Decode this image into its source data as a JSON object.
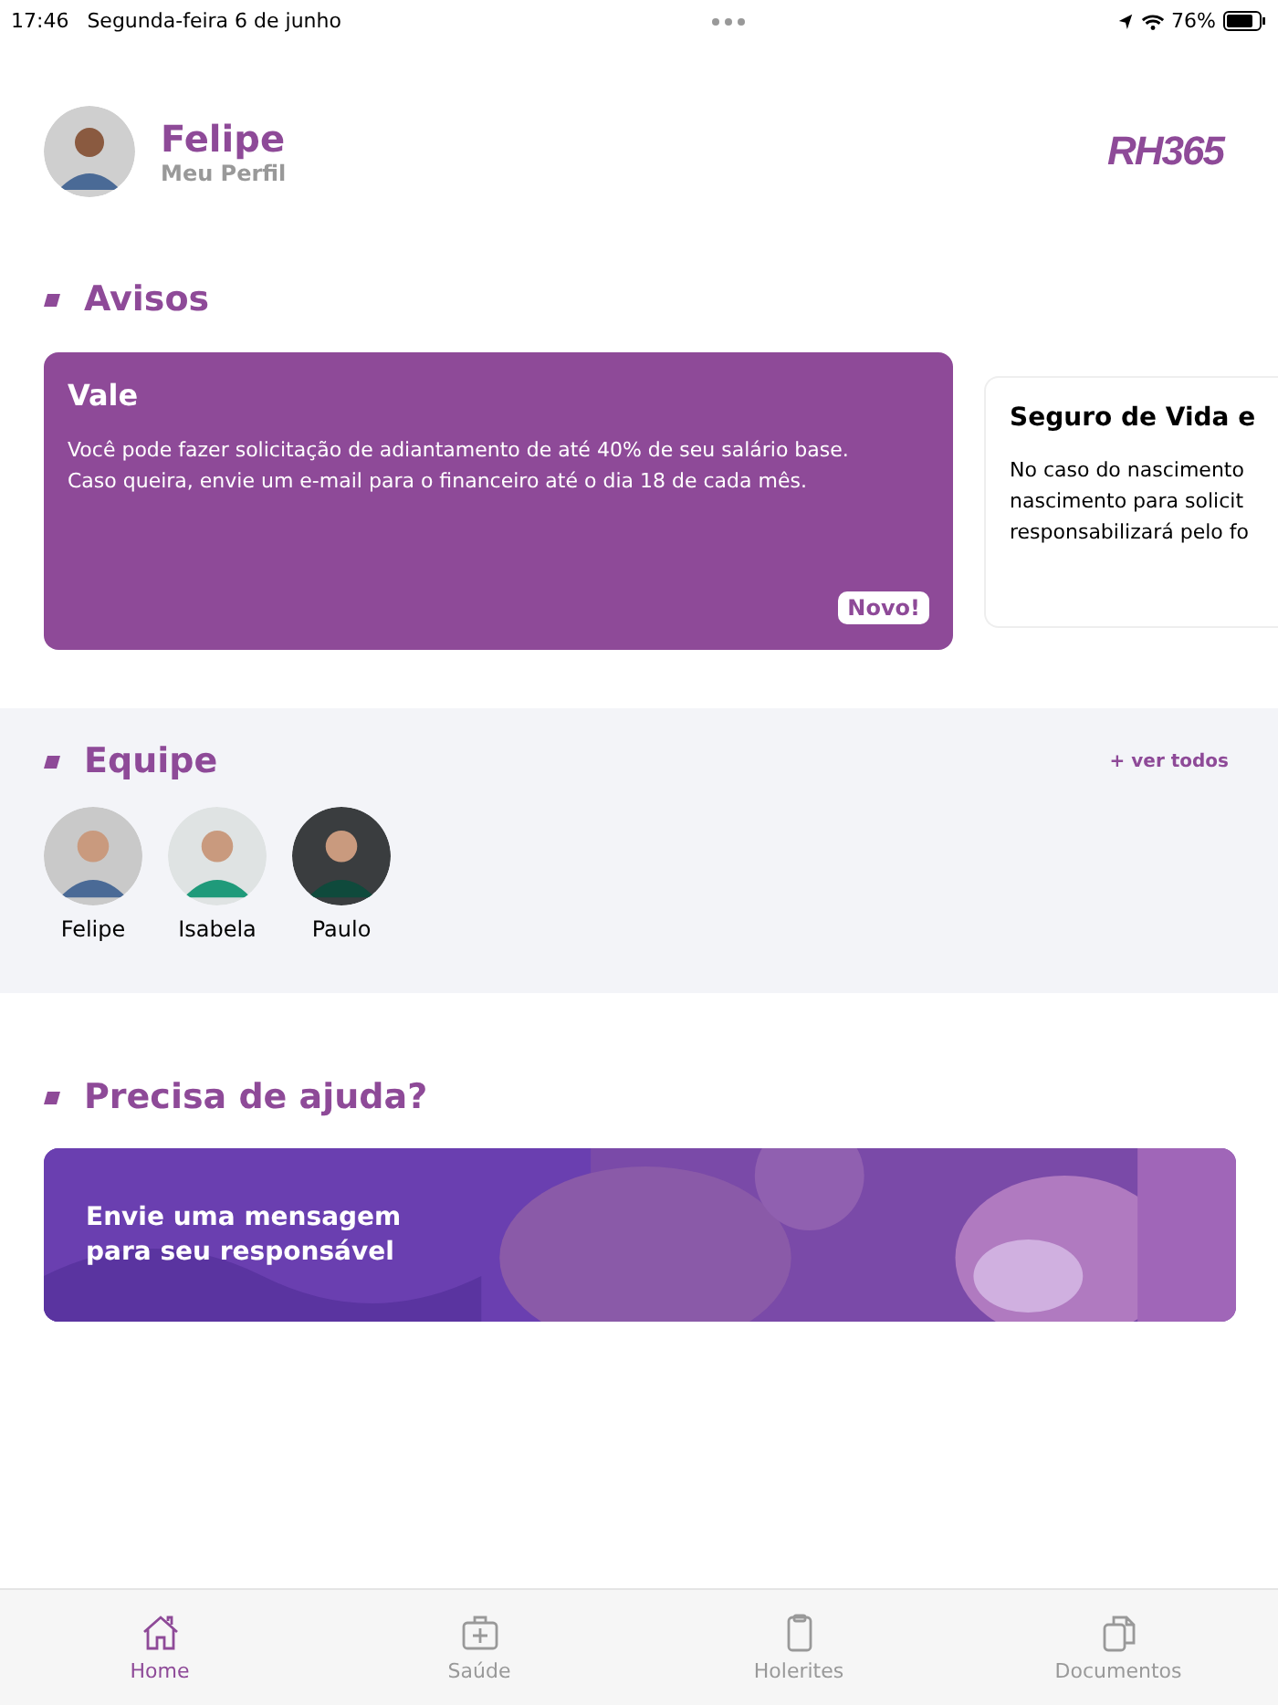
{
  "status_bar": {
    "time": "17:46",
    "date": "Segunda-feira 6 de junho",
    "battery": "76%"
  },
  "profile": {
    "name": "Felipe",
    "subtitle": "Meu Perfil",
    "logo": "RH365"
  },
  "notices": {
    "title": "Avisos",
    "cards": [
      {
        "kind": "highlight",
        "title": "Vale",
        "lines": [
          "Você pode fazer solicitação de adiantamento de até 40% de seu salário base. Caso queira, envie um e-mail para o financeiro até o dia 18 de cada mês."
        ],
        "badge": "Novo!"
      },
      {
        "kind": "plain",
        "title": "Seguro de Vida e",
        "lines": [
          "No caso do nascimento",
          "nascimento para solicit",
          "responsabilizará pelo fo"
        ]
      }
    ]
  },
  "team": {
    "title": "Equipe",
    "link": "+ ver todos",
    "members": [
      {
        "name": "Felipe",
        "color": "#c9c9c9"
      },
      {
        "name": "Isabela",
        "color": "#dfe3e3"
      },
      {
        "name": "Paulo",
        "color": "#3a3d3f"
      }
    ]
  },
  "help": {
    "title": "Precisa de ajuda?",
    "banner": "Envie uma mensagem para seu responsável"
  },
  "tabs": [
    {
      "label": "Home",
      "kind": "home",
      "selected": true
    },
    {
      "label": "Saúde",
      "kind": "health",
      "selected": false
    },
    {
      "label": "Holerites",
      "kind": "payslips",
      "selected": false
    },
    {
      "label": "Documentos",
      "kind": "documents",
      "selected": false
    }
  ]
}
